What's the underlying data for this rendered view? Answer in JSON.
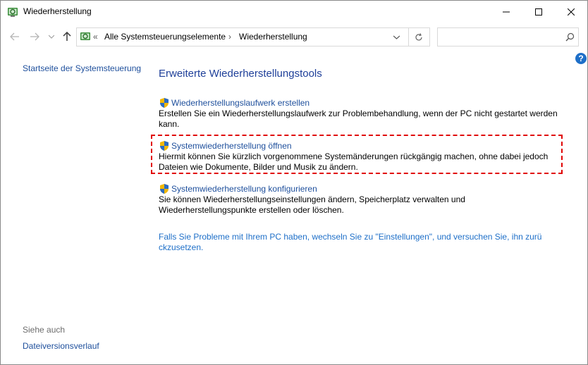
{
  "window": {
    "title": "Wiederherstellung",
    "controls": [
      "minimize",
      "maximize",
      "close"
    ]
  },
  "navigation": {
    "overflow": "«",
    "breadcrumbs": [
      "Alle Systemsteuerungselemente",
      "Wiederherstellung"
    ],
    "search": {
      "placeholder": "",
      "value": ""
    }
  },
  "left_pane": {
    "home_link": "Startseite der Systemsteuerung",
    "see_also_label": "Siehe auch",
    "see_also_links": [
      "Dateiversionsverlauf"
    ]
  },
  "main": {
    "heading": "Erweiterte Wiederherstellungstools",
    "tasks": [
      {
        "title": "Wiederherstellungslaufwerk erstellen",
        "description": "Erstellen Sie ein Wiederherstellungslaufwerk zur Problembehandlung, wenn der PC nicht gestartet werden kann."
      },
      {
        "title": "Systemwiederherstellung öffnen",
        "description": "Hiermit können Sie kürzlich vorgenommene Systemänderungen rückgängig machen, ohne dabei jedoch Dateien wie Dokumente, Bilder und Musik zu ändern.",
        "highlighted": true
      },
      {
        "title": "Systemwiederherstellung konfigurieren",
        "description": "Sie können Wiederherstellungseinstellungen ändern, Speicherplatz verwalten und Wiederherstellungspunkte erstellen oder löschen."
      }
    ],
    "footer_link": "Falls Sie Probleme mit Ihrem PC haben, wechseln Sie zu \"Einstellungen\", und versuchen Sie, ihn zurü ckzusetzen."
  },
  "colors": {
    "link": "#1e4f9c",
    "heading": "#1e3f99",
    "highlight_border": "#e00000",
    "help_badge": "#1e6fc8"
  }
}
